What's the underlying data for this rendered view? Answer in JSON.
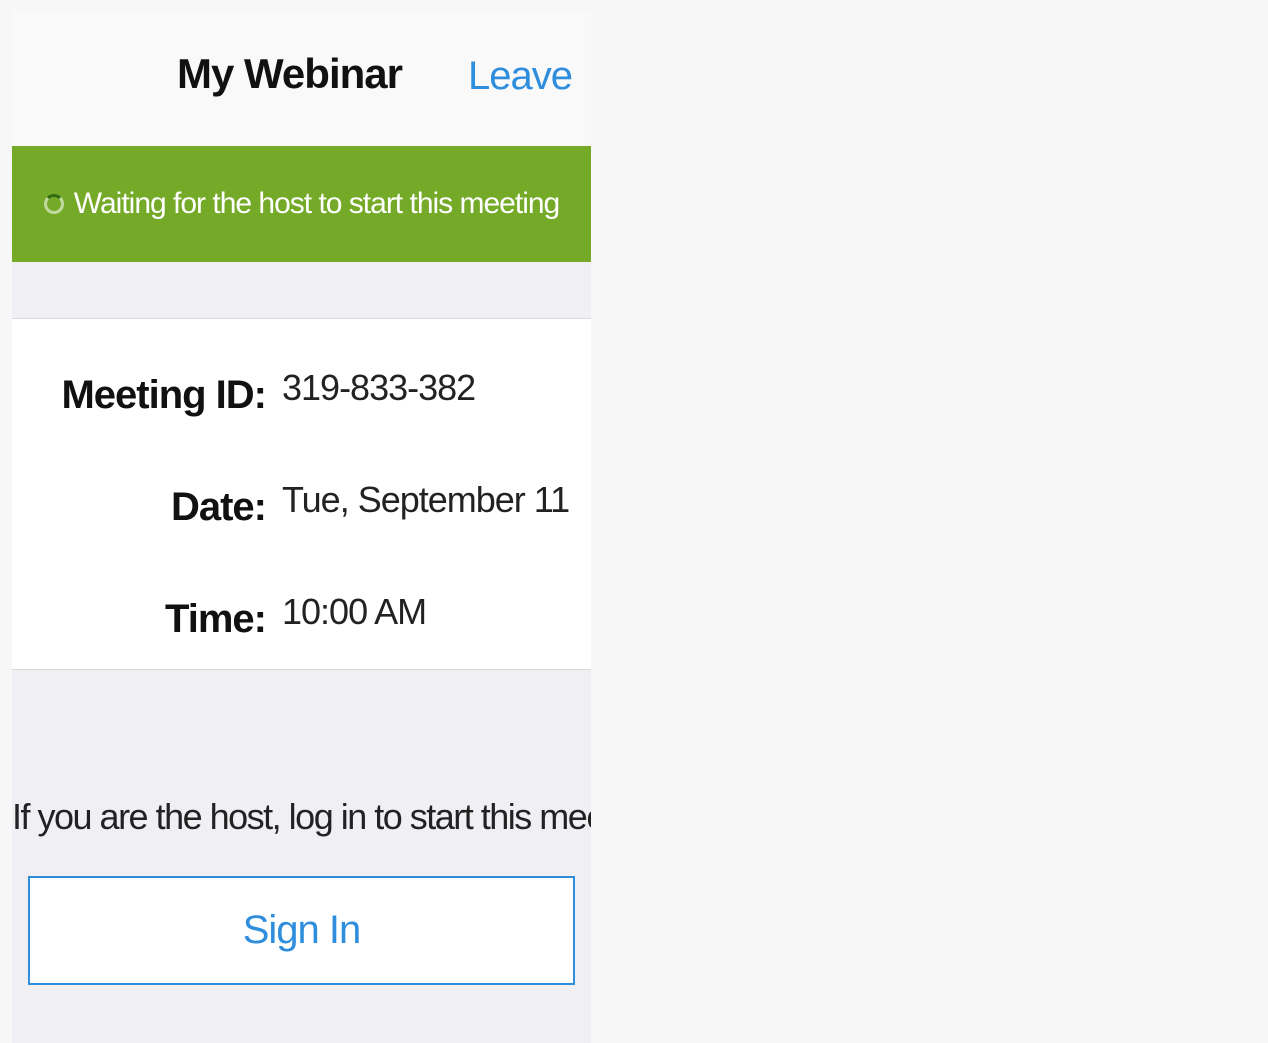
{
  "header": {
    "title": "My Webinar",
    "leave_label": "Leave"
  },
  "banner": {
    "status_text": "Waiting for the host to start this meeting",
    "spinner_icon": "loading-spinner-icon",
    "background_color": "#75aa28"
  },
  "meeting": {
    "rows": [
      {
        "label": "Meeting ID:",
        "value": "319-833-382"
      },
      {
        "label": "Date:",
        "value": "Tue, September 11"
      },
      {
        "label": "Time:",
        "value": "10:00 AM"
      }
    ]
  },
  "host_prompt": {
    "text": "If you are the host, log in to start this meeting",
    "signin_label": "Sign In"
  },
  "colors": {
    "accent": "#2e8ddd",
    "banner": "#75aa28",
    "background": "#efeff4"
  }
}
